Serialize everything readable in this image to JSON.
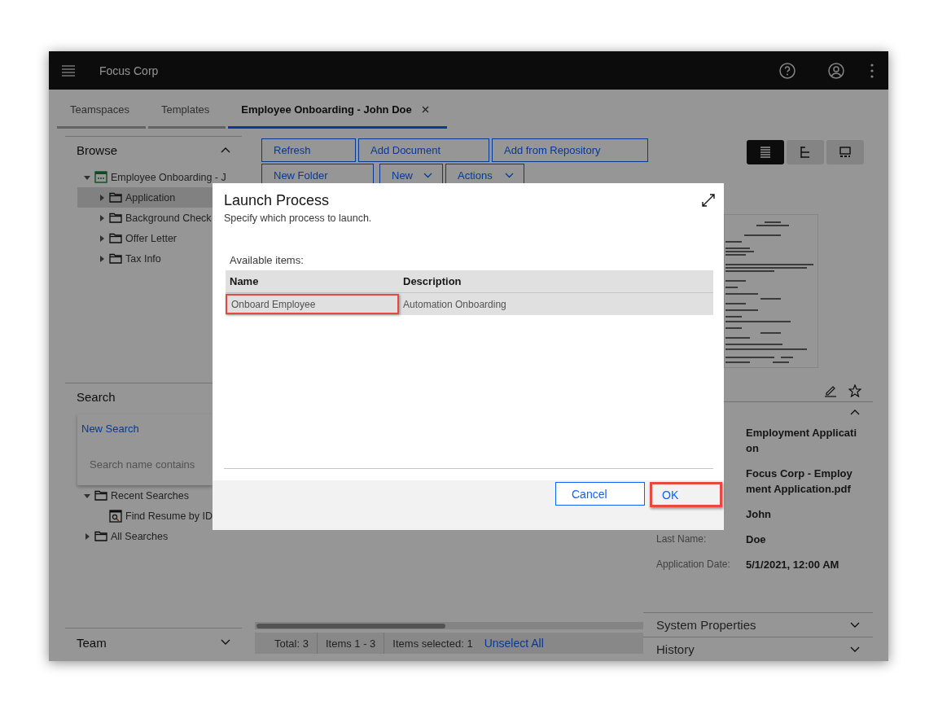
{
  "header": {
    "title": "Focus Corp"
  },
  "tabs": [
    {
      "label": "Teamspaces",
      "selected": false,
      "closable": false
    },
    {
      "label": "Templates",
      "selected": false,
      "closable": false
    },
    {
      "label": "Employee Onboarding - John Doe",
      "selected": true,
      "closable": true
    }
  ],
  "browse": {
    "title": "Browse",
    "expanded": true,
    "tree": [
      {
        "label": "Employee Onboarding - J",
        "kind": "case",
        "expanded": true,
        "selected": false,
        "children": [
          {
            "label": "Application",
            "kind": "folder",
            "expanded": false,
            "selected": true
          },
          {
            "label": "Background Check",
            "kind": "folder",
            "expanded": false,
            "selected": false
          },
          {
            "label": "Offer Letter",
            "kind": "folder",
            "expanded": false,
            "selected": false
          },
          {
            "label": "Tax Info",
            "kind": "folder",
            "expanded": false,
            "selected": false
          }
        ]
      }
    ]
  },
  "search": {
    "title": "Search",
    "new_search": "New Search",
    "placeholder": "Search name contains",
    "tree": [
      {
        "label": "Recent Searches",
        "kind": "folder",
        "expanded": true,
        "selected": false,
        "children": [
          {
            "label": "Find Resume by ID",
            "kind": "search",
            "selected": false
          }
        ]
      },
      {
        "label": "All Searches",
        "kind": "folder",
        "expanded": false,
        "selected": false
      }
    ]
  },
  "team": {
    "title": "Team",
    "expanded": false
  },
  "toolbar": [
    {
      "label": "Refresh",
      "menu": false
    },
    {
      "label": "Add Document",
      "menu": false
    },
    {
      "label": "Add from Repository",
      "menu": false
    },
    {
      "label": "New Folder",
      "menu": false
    },
    {
      "label": "New",
      "menu": true
    },
    {
      "label": "Actions",
      "menu": true
    }
  ],
  "view_modes": [
    {
      "kind": "list",
      "selected": true
    },
    {
      "kind": "tree",
      "selected": false
    },
    {
      "kind": "filmstrip",
      "selected": false
    }
  ],
  "properties": {
    "expanded": true,
    "rows": [
      {
        "value": "Employment Application"
      },
      {
        "value": "Focus Corp - Employment Application.pdf"
      },
      {
        "value": "John"
      },
      {
        "label": "Last Name:",
        "value": "Doe"
      },
      {
        "label": "Application Date:",
        "value": "5/1/2021, 12:00 AM"
      }
    ]
  },
  "sections": [
    {
      "title": "System Properties",
      "expanded": false
    },
    {
      "title": "History",
      "expanded": false
    }
  ],
  "status_bar": {
    "total": "Total: 3",
    "range": "Items 1 - 3",
    "selection": "Items selected: 1",
    "unselect": "Unselect All"
  },
  "dialog": {
    "title": "Launch Process",
    "subtitle": "Specify which process to launch.",
    "list_label": "Available items:",
    "columns": [
      "Name",
      "Description"
    ],
    "rows": [
      {
        "selected": true,
        "cells": [
          {
            "text": "Onboard Employee",
            "highlighted": true
          },
          {
            "text": "Automation Onboarding",
            "highlighted": false
          }
        ]
      }
    ],
    "buttons": [
      {
        "label": "Cancel",
        "highlighted": false
      },
      {
        "label": "OK",
        "highlighted": true
      }
    ]
  }
}
